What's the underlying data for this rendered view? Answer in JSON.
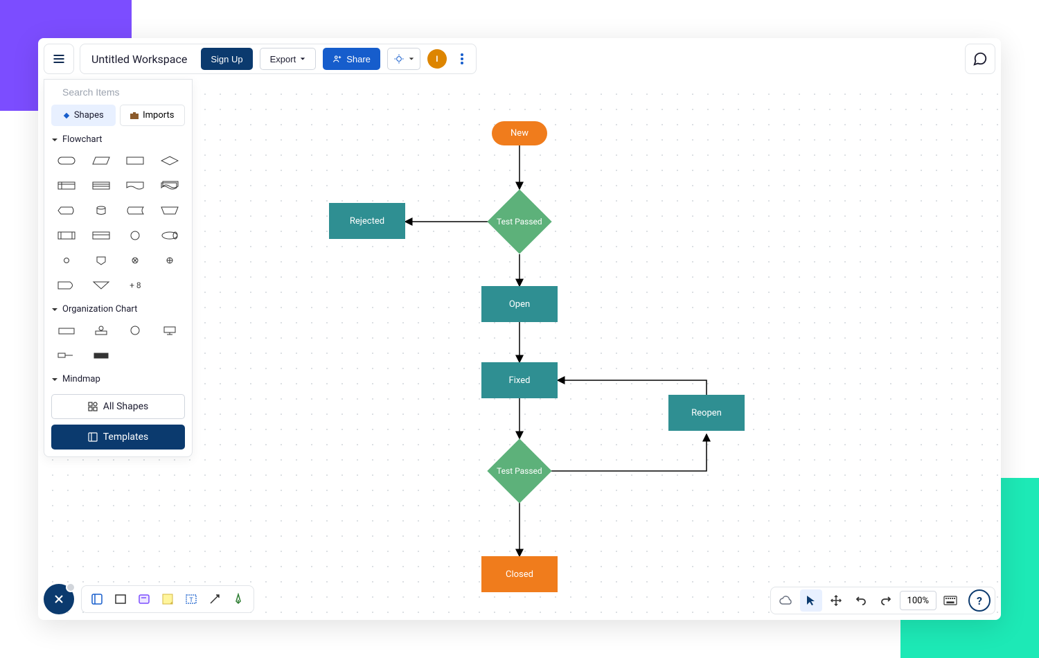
{
  "header": {
    "workspace_title": "Untitled Workspace",
    "signup_label": "Sign Up",
    "export_label": "Export",
    "share_label": "Share",
    "avatar_initial": "I"
  },
  "sidebar": {
    "search_placeholder": "Search Items",
    "tabs": {
      "shapes": "Shapes",
      "imports": "Imports"
    },
    "sections": {
      "flowchart": "Flowchart",
      "orgchart": "Organization Chart",
      "mindmap": "Mindmap"
    },
    "more_shapes": "+ 8",
    "all_shapes": "All Shapes",
    "templates": "Templates"
  },
  "footer": {
    "zoom": "100%"
  },
  "diagram": {
    "nodes": {
      "new": "New",
      "test1": "Test Passed",
      "rejected": "Rejected",
      "open": "Open",
      "fixed": "Fixed",
      "test2": "Test Passed",
      "reopen": "Reopen",
      "closed": "Closed"
    }
  },
  "colors": {
    "orange": "#f07c1c",
    "green": "#5db17a",
    "teal": "#2f8f92",
    "navy": "#0b3a6e",
    "blue": "#165dcc"
  }
}
